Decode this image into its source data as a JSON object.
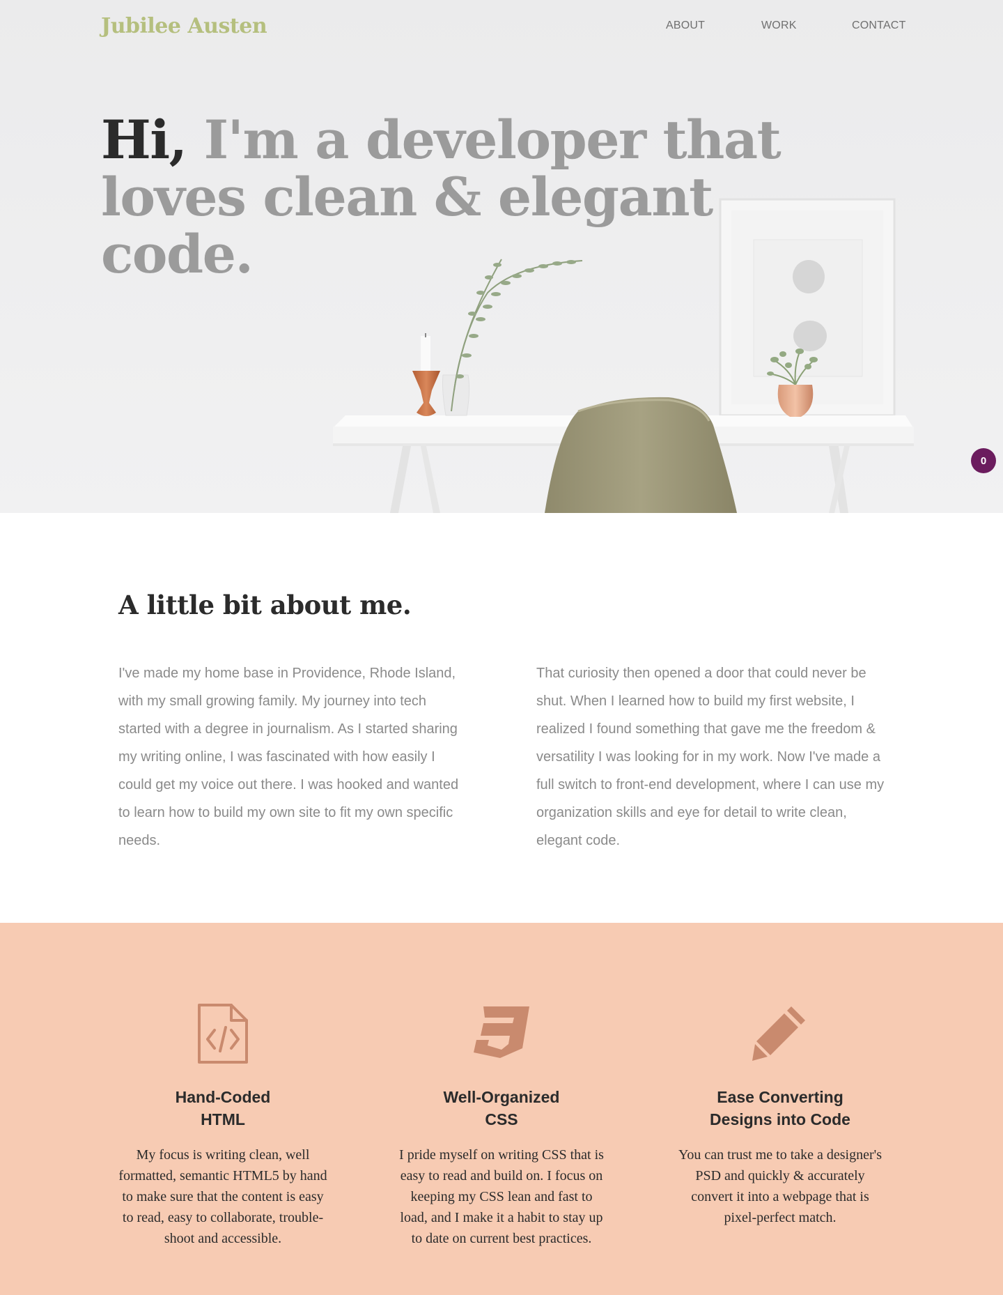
{
  "header": {
    "logo": "Jubilee Austen",
    "nav": [
      "ABOUT",
      "WORK",
      "CONTACT"
    ]
  },
  "hero": {
    "greeting": "Hi,",
    "headline_rest": " I'm a developer that loves clean & elegant code.",
    "badge_count": "0"
  },
  "about": {
    "title": "A little bit about me.",
    "paragraphs": [
      "I've made my home base in Providence, Rhode Island, with my small growing family. My journey into tech started with a degree in journalism. As I started sharing my writing online, I was fascinated with how easily I could get my voice out there. I was hooked and wanted to learn how to build my own site to fit my own specific needs.",
      "That curiosity then opened a door that could never be shut. When I learned how to build my first website, I realized I found something that gave me the freedom & versatility I was looking for in my work. Now I've made a full switch to front-end development, where I can use my organization skills and eye for detail to write clean, elegant code."
    ]
  },
  "skills": [
    {
      "icon": "html-file-code-icon",
      "title_line1": "Hand-Coded",
      "title_line2": "HTML",
      "text": "My focus is writing clean, well formatted, semantic HTML5 by hand to make sure that the content is easy to read, easy to collaborate, trouble-shoot and accessible."
    },
    {
      "icon": "css3-icon",
      "title_line1": "Well-Organized",
      "title_line2": "CSS",
      "text": "I pride myself on writing CSS that is easy to read and build on. I focus on keeping my CSS lean and fast to load, and I make it a habit to stay up to date on current best practices."
    },
    {
      "icon": "pencil-icon",
      "title_line1": "Ease Converting",
      "title_line2": "Designs into Code",
      "text": "You can trust me to take a designer's PSD and quickly & accurately convert it into a webpage that is pixel-perfect match."
    }
  ],
  "colors": {
    "logo": "#b5bf7e",
    "headline_dark": "#2b2b2b",
    "headline_gray": "#9b9b9b",
    "skills_bg": "#f7cbb3",
    "skill_icon": "#c98a6e",
    "badge": "#6b1c5e"
  }
}
